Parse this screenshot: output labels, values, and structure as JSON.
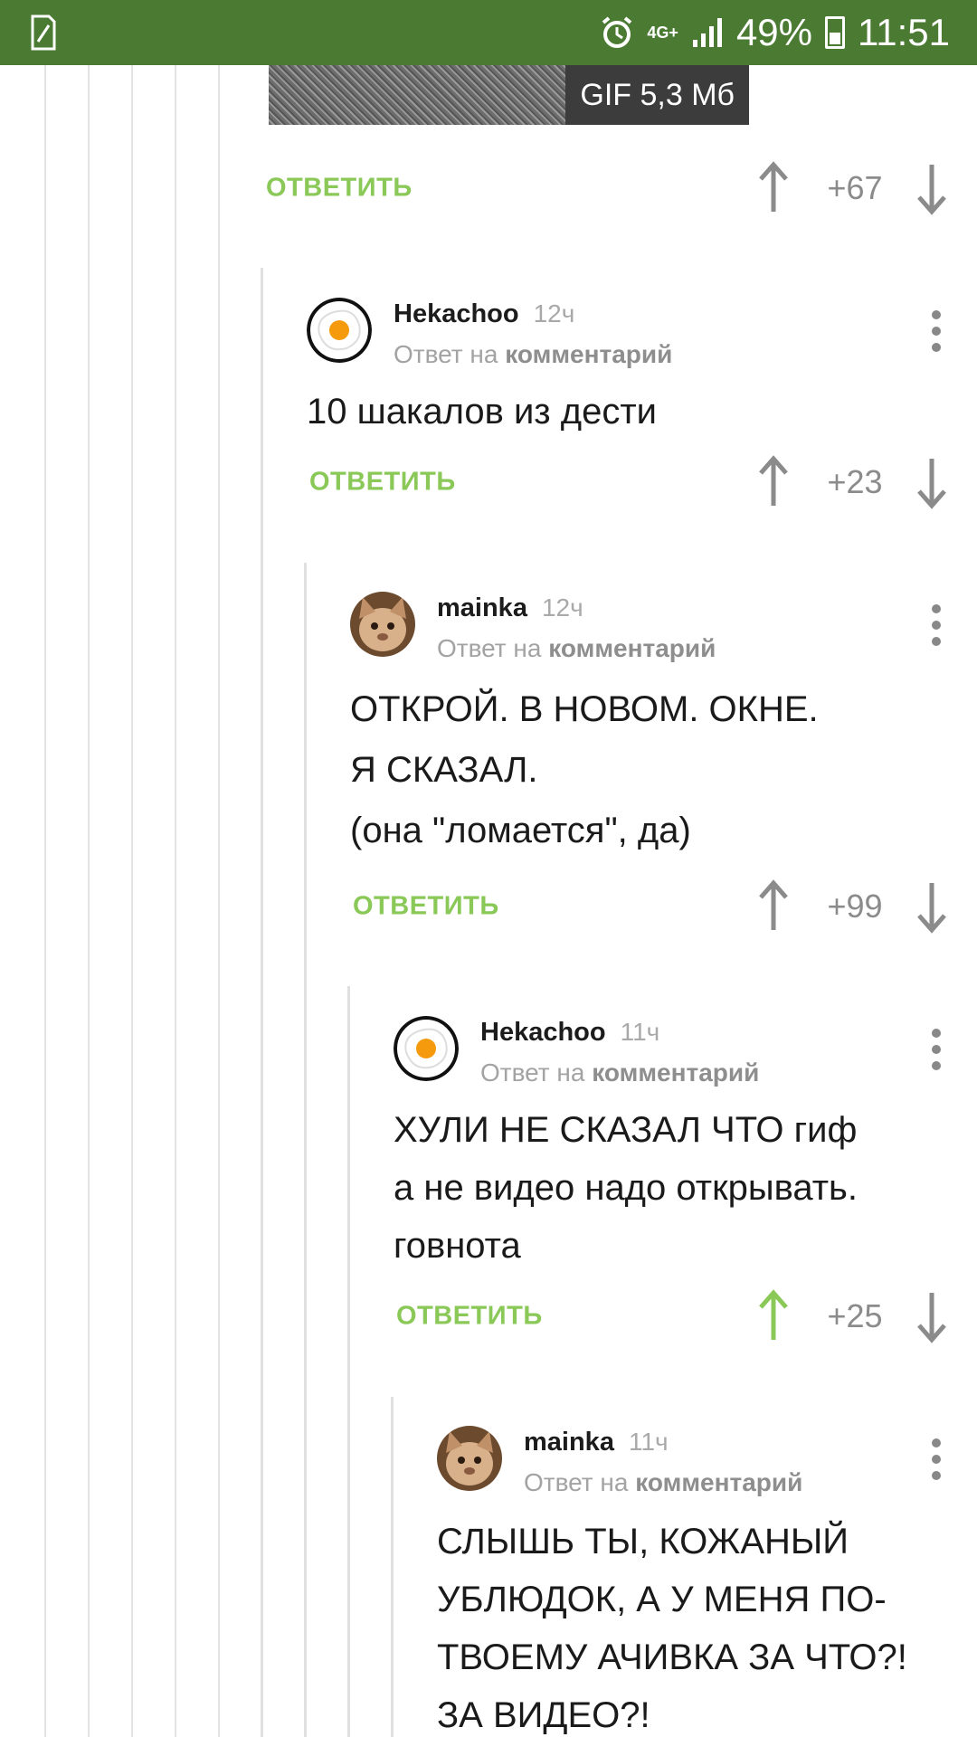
{
  "status_bar": {
    "network": "4G+",
    "battery": "49%",
    "time": "11:51"
  },
  "gif": {
    "badge": "GIF 5,3 Мб"
  },
  "top_actions": {
    "reply": "ОТВЕТИТЬ",
    "score": "+67"
  },
  "comments": [
    {
      "author": "Hekachoo",
      "time": "12ч",
      "reply_prefix": "Ответ на",
      "reply_link": "комментарий",
      "text": "10 шакалов из дести",
      "reply": "ОТВЕТИТЬ",
      "score": "+23"
    },
    {
      "author": "mainka",
      "time": "12ч",
      "reply_prefix": "Ответ на",
      "reply_link": "комментарий",
      "text": "ОТКРОЙ. В НОВОМ. ОКНЕ.\nЯ СКАЗАЛ.\n(она \"ломается\", да)",
      "reply": "ОТВЕТИТЬ",
      "score": "+99"
    },
    {
      "author": "Hekachoo",
      "time": "11ч",
      "reply_prefix": "Ответ на",
      "reply_link": "комментарий",
      "text": "ХУЛИ НЕ СКАЗАЛ ЧТО гиф\nа не видео надо открывать.\nговнота",
      "reply": "ОТВЕТИТЬ",
      "score": "+25",
      "upvoted": true
    },
    {
      "author": "mainka",
      "time": "11ч",
      "reply_prefix": "Ответ на",
      "reply_link": "комментарий",
      "text": "СЛЫШЬ ТЫ, КОЖАНЫЙ\nУБЛЮДОК, А У МЕНЯ ПО-\nТВОЕМУ АЧИВКА ЗА ЧТО?!\nЗА ВИДЕО?!"
    }
  ],
  "colors": {
    "status_bar": "#4b7b33",
    "accent_green": "#8ac858",
    "arrow_gray": "#8b8b8b"
  }
}
